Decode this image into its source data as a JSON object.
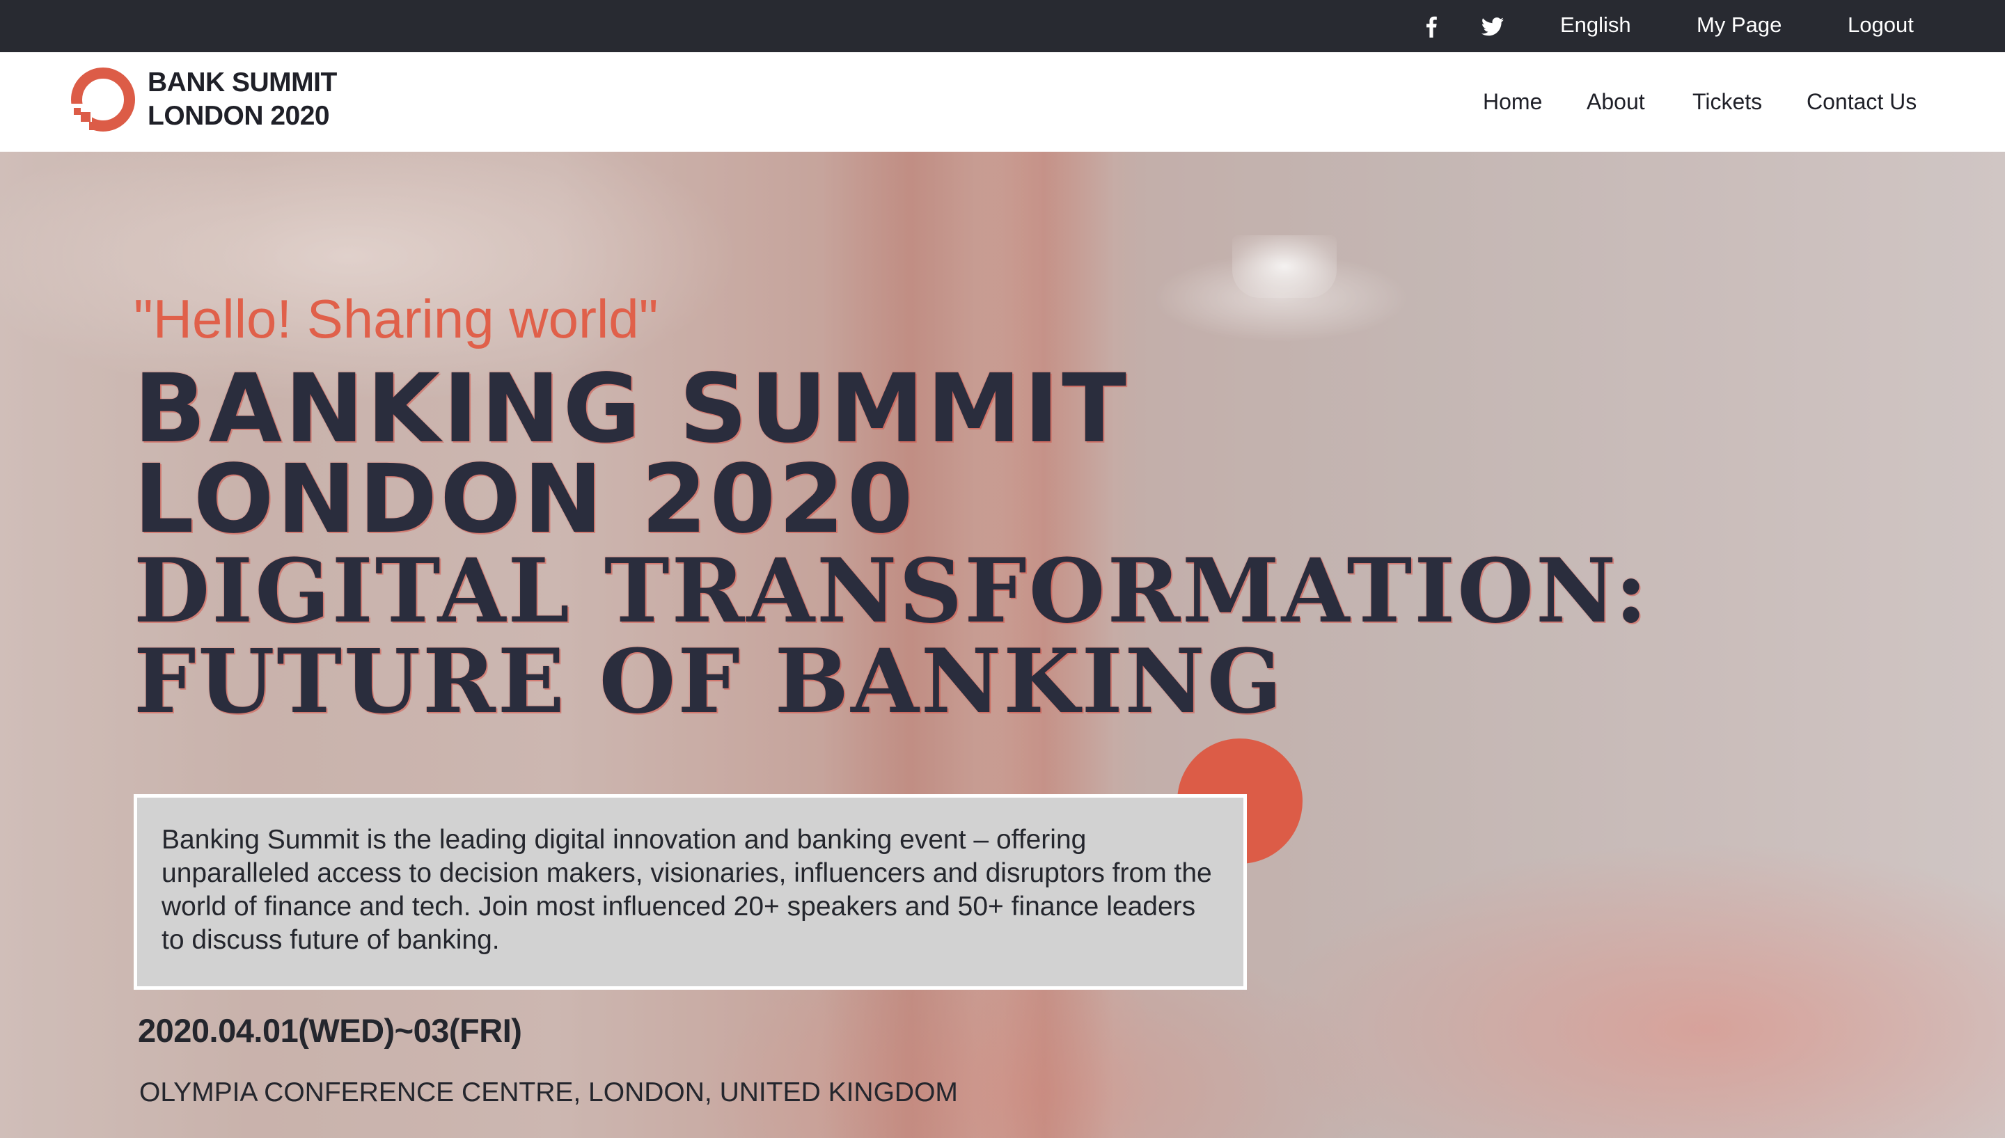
{
  "topbar": {
    "social": [
      {
        "icon": "facebook-icon"
      },
      {
        "icon": "twitter-icon"
      }
    ],
    "language": "English",
    "my_page": "My Page",
    "logout": "Logout"
  },
  "header": {
    "logo_line1": "BANK SUMMIT",
    "logo_line2": "LONDON 2020",
    "nav": [
      "Home",
      "About",
      "Tickets",
      "Contact Us"
    ]
  },
  "hero": {
    "tagline": "\"Hello! Sharing world\"",
    "title_line1": "BANKING SUMMIT",
    "title_line2": "LONDON 2020",
    "title_line3": "DIGITAL TRANSFORMATION:",
    "title_line4": "FUTURE OF BANKING",
    "description": "Banking Summit is the leading digital innovation and banking event – offering unparalleled access to decision makers, visionaries, influencers and disruptors from the world of finance and tech. Join most influenced 20+ speakers and 50+ finance leaders to discuss future of banking.",
    "date": "2020.04.01(WED)~03(FRI)",
    "venue": "OLYMPIA CONFERENCE CENTRE, LONDON, UNITED KINGDOM"
  },
  "colors": {
    "topbar_bg": "#282a31",
    "accent": "#dc5c47",
    "tagline": "#e0604a",
    "title": "#2a2d3d",
    "text_dark": "#24262d"
  }
}
